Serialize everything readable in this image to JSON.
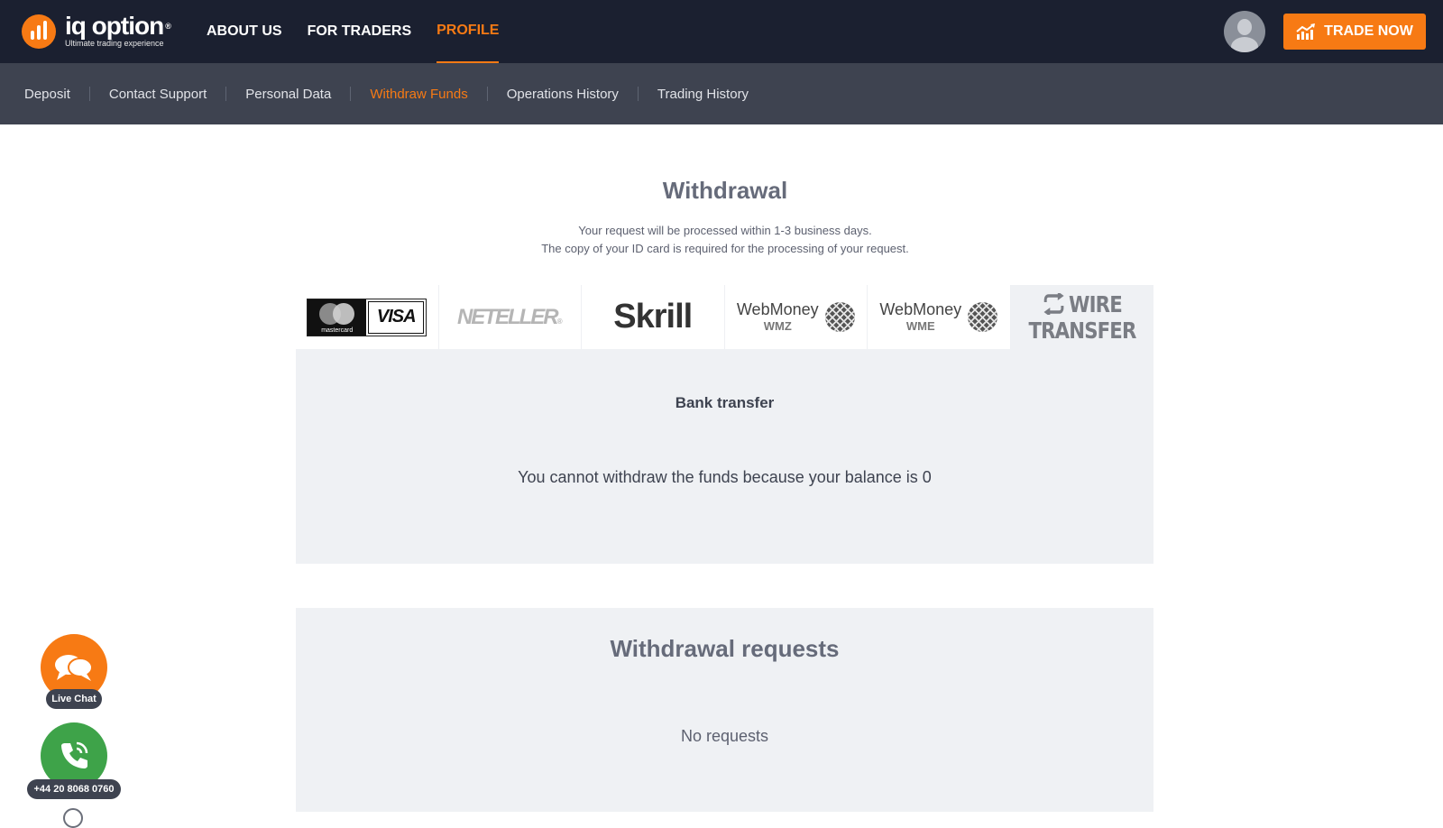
{
  "brand": {
    "name": "iq option",
    "reg_mark": "®",
    "tagline": "Ultimate trading experience"
  },
  "main_nav": [
    {
      "label": "ABOUT US",
      "active": false
    },
    {
      "label": "FOR TRADERS",
      "active": false
    },
    {
      "label": "PROFILE",
      "active": true
    }
  ],
  "header": {
    "trade_button": "TRADE NOW",
    "trade_icon": "chart-up-icon",
    "avatar_icon": "user-avatar-icon"
  },
  "sub_nav": [
    {
      "label": "Deposit",
      "active": false
    },
    {
      "label": "Contact Support",
      "active": false
    },
    {
      "label": "Personal Data",
      "active": false
    },
    {
      "label": "Withdraw Funds",
      "active": true
    },
    {
      "label": "Operations History",
      "active": false
    },
    {
      "label": "Trading History",
      "active": false
    }
  ],
  "withdrawal": {
    "title": "Withdrawal",
    "note_line1": "Your request will be processed within 1-3 business days.",
    "note_line2": "The copy of your ID card is required for the processing of your request.",
    "methods": {
      "cards": {
        "mastercard": "mastercard",
        "visa": "VISA"
      },
      "neteller": {
        "name": "NETELLER",
        "mark": "®"
      },
      "skrill": {
        "name": "Skrill"
      },
      "wmz": {
        "name": "WebMoney",
        "currency": "WMZ"
      },
      "wme": {
        "name": "WebMoney",
        "currency": "WME"
      },
      "wire": {
        "line1": "WIRE",
        "line2": "TRANSFER",
        "active": true
      }
    },
    "panel_title": "Bank transfer",
    "panel_message": "You cannot withdraw the funds because your balance is 0"
  },
  "requests": {
    "title": "Withdrawal requests",
    "empty_text": "No requests"
  },
  "widgets": {
    "chat_label": "Live Chat",
    "phone_label": "+44 20 8068 0760"
  },
  "colors": {
    "accent": "#f77a14",
    "topbar": "#1b2030",
    "subnav": "#3e4350",
    "panel": "#eff1f4",
    "call": "#3ea349"
  }
}
